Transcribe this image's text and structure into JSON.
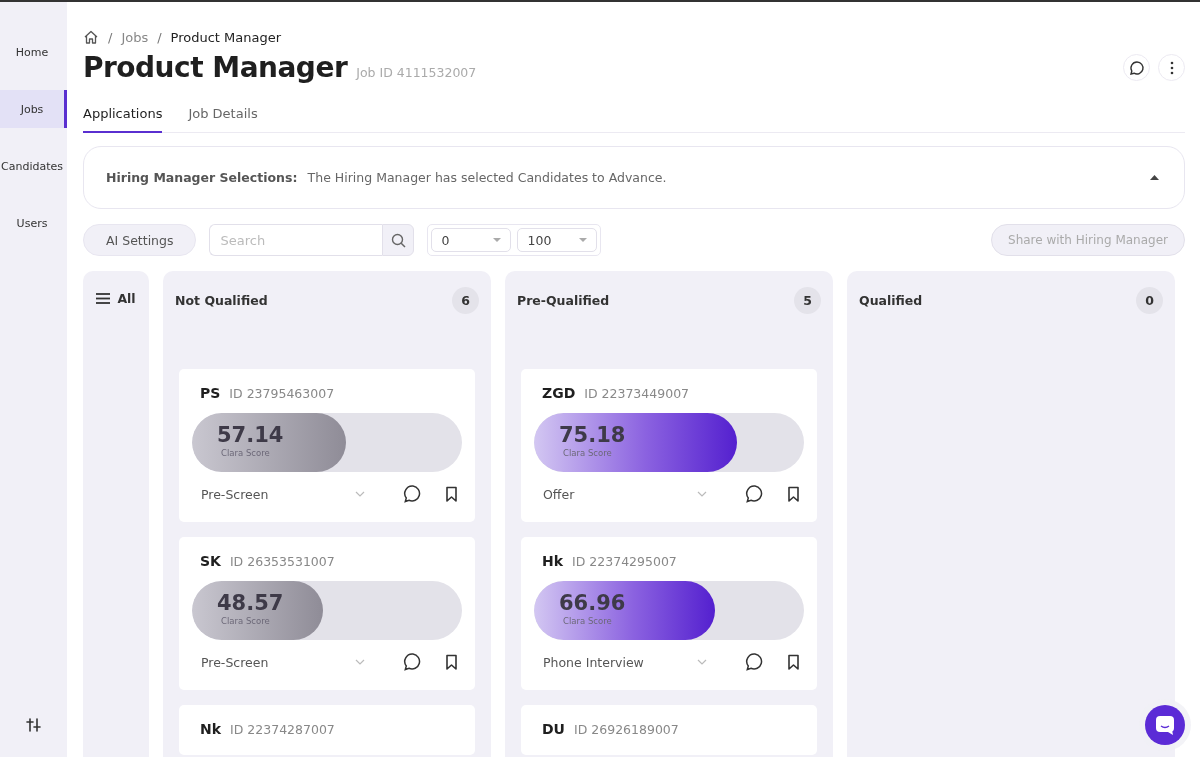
{
  "sidebar": {
    "items": [
      {
        "label": "Home",
        "selected": false
      },
      {
        "label": "Jobs",
        "selected": true
      },
      {
        "label": "Candidates",
        "selected": false
      },
      {
        "label": "Users",
        "selected": false
      }
    ]
  },
  "breadcrumb": [
    {
      "separator": "/",
      "label": "Jobs"
    },
    {
      "separator": "/",
      "label": "Product Manager"
    }
  ],
  "page": {
    "title": "Product Manager",
    "job_id": "Job ID 4111532007"
  },
  "tabs": [
    {
      "label": "Applications",
      "selected": true
    },
    {
      "label": "Job Details",
      "selected": false
    }
  ],
  "banner": {
    "label": "Hiring Manager Selections:",
    "text": "The Hiring Manager has selected Candidates to Advance.",
    "expanded": true
  },
  "toolbar": {
    "ai_settings": "AI Settings",
    "search": {
      "placeholder": "Search"
    },
    "min_score": "0",
    "max_score": "100",
    "share": {
      "label": "Share with Hiring Manager",
      "disabled": true
    }
  },
  "all_column": {
    "label": "All"
  },
  "columns": [
    {
      "title": "Not Qualified",
      "count": "6",
      "kind": "grey",
      "cards": [
        {
          "initials": "PS",
          "id": "ID 23795463007",
          "score": "57.14",
          "level": 0.5714,
          "score_label": "Clara Score",
          "stage": "Pre-Screen"
        },
        {
          "initials": "SK",
          "id": "ID 26353531007",
          "score": "48.57",
          "level": 0.4857,
          "score_label": "Clara Score",
          "stage": "Pre-Screen"
        },
        {
          "initials": "Nk",
          "id": "ID 22374287007"
        }
      ]
    },
    {
      "title": "Pre-Qualified",
      "count": "5",
      "kind": "purple",
      "cards": [
        {
          "initials": "ZGD",
          "id": "ID 22373449007",
          "score": "75.18",
          "level": 0.7518,
          "score_label": "Clara Score",
          "stage": "Offer"
        },
        {
          "initials": "Hk",
          "id": "ID 22374295007",
          "score": "66.96",
          "level": 0.6696,
          "score_label": "Clara Score",
          "stage": "Phone Interview"
        },
        {
          "initials": "DU",
          "id": "ID 26926189007"
        }
      ]
    },
    {
      "title": "Qualified",
      "count": "0"
    }
  ]
}
